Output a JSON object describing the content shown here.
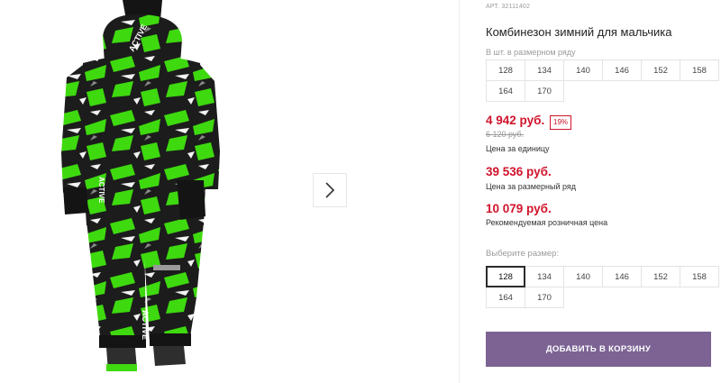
{
  "product": {
    "article_label": "АРТ. 32111402",
    "title": "Комбинезон зимний для мальчика"
  },
  "size_row": {
    "hint": "В шт. в размерном ряду",
    "sizes": [
      "128",
      "134",
      "140",
      "146",
      "152",
      "158",
      "164",
      "170"
    ]
  },
  "prices": {
    "unit_price": "4 942 руб.",
    "discount": "19%",
    "old_price": "6 120 руб.",
    "unit_caption": "Цена за единицу",
    "row_price": "39 536 руб.",
    "row_caption": "Цена за размерный ряд",
    "retail_price": "10 079 руб.",
    "retail_caption": "Рекомендуемая розничная цена"
  },
  "size_picker": {
    "label": "Выберите размер:",
    "selected": "128",
    "sizes": [
      "128",
      "134",
      "140",
      "146",
      "152",
      "158",
      "164",
      "170"
    ]
  },
  "cart": {
    "button_label": "ДОБАВИТЬ В КОРЗИНУ"
  },
  "gallery": {
    "next_icon": "chevron-right-icon",
    "garment_print_text": "ACTIVE"
  },
  "colors": {
    "price_red": "#d0142c",
    "cart_purple": "#7c6394",
    "print_green": "#3ed90f",
    "print_black": "#1c1c1c"
  }
}
